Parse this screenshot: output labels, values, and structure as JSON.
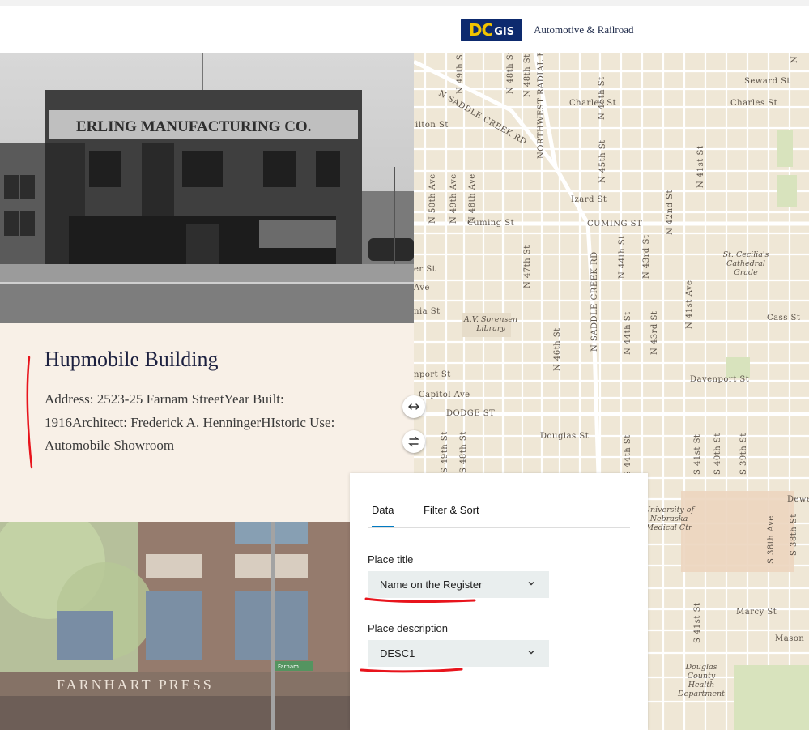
{
  "header": {
    "logo_primary": "DC",
    "logo_secondary": "GIS",
    "subtitle": "Automotive & Railroad"
  },
  "photo1": {
    "sign_text": "ERLING MANUFACTURING CO."
  },
  "place": {
    "title": "Hupmobile Building",
    "description": "Address: 2523-25 Farnam StreetYear Built: 1916Architect: Frederick A. HenningerHIstoric Use: Automobile Showroom"
  },
  "photo2": {
    "sign_text": "FARNHART PRESS",
    "street_sign": "Farnam"
  },
  "map": {
    "labels": [
      "Seward St",
      "Charles St",
      "Charles St",
      "ilton St",
      "N SADDLE CREEK RD",
      "NORTHWEST RADIAL H",
      "Izard St",
      "Cuming St",
      "CUMING ST",
      "St. Cecilia's Cathedral Grade",
      "er St",
      "Ave",
      "nia St",
      "A.V. Sorensen Library",
      "Cass St",
      "Davenport St",
      "nport St",
      "Capitol Ave",
      "DODGE ST",
      "Douglas St",
      "Dewe",
      "University of Nebraska Medical Ctr",
      "Marcy St",
      "Mason",
      "Douglas County Health Department",
      "N 50th Ave",
      "N 49th Ave",
      "N 48th Ave",
      "N 47th St",
      "N 46th St",
      "N 45th St",
      "N 44th St",
      "N 43rd St",
      "N 42nd St",
      "N 41st St",
      "N 41st Ave",
      "N SADDLE CREEK RD",
      "N 44th St",
      "N 43rd St",
      "N 48th St",
      "N 49th St",
      "S 49th St",
      "S 48th St",
      "S 44th St",
      "S 41st St",
      "S 40th St",
      "S 39th St",
      "S 38th St",
      "S 38th Ave",
      "S 41st St",
      "N 45th St",
      "N 48th St",
      "N 4"
    ]
  },
  "controls": {
    "swap_horizontal_icon": "left-right-arrows",
    "swap_vertical_icon": "swap-arrows"
  },
  "panel": {
    "tabs": [
      {
        "label": "Data",
        "active": true
      },
      {
        "label": "Filter & Sort",
        "active": false
      }
    ],
    "place_title_label": "Place title",
    "place_title_value": "Name on the Register",
    "place_description_label": "Place description",
    "place_description_value": "DESC1"
  },
  "colors": {
    "accent_tab": "#007ac2",
    "annotation_red": "#e8141c",
    "logo_bg": "#0d2a6e",
    "logo_yellow": "#f2c400",
    "card_bg": "#f8f0e7",
    "map_bg": "#efe7d6"
  }
}
